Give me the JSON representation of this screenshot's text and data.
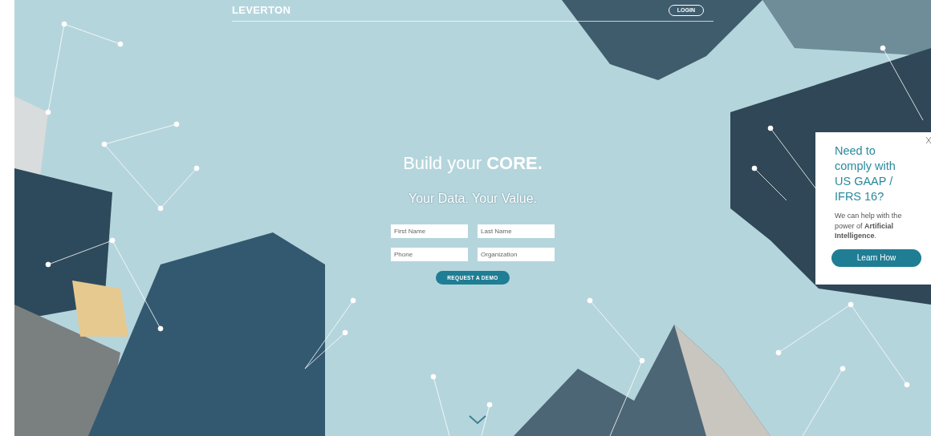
{
  "header": {
    "logo": "LEVERTON",
    "login": "LOGIN"
  },
  "hero": {
    "title": "Build your **CORE.**",
    "subtitle": "Your Data. Your Value."
  },
  "form": {
    "fields": [
      {
        "placeholder": "First Name"
      },
      {
        "placeholder": "Last Name"
      },
      {
        "placeholder": "Phone"
      },
      {
        "placeholder": "Organization"
      }
    ],
    "submit": "REQUEST A DEMO"
  },
  "popup": {
    "heading": "Need to comply with US GAAP / IFRS 16?",
    "body": "We can help with the power of **Artificial Intelligence**.",
    "button": "Learn How"
  }
}
